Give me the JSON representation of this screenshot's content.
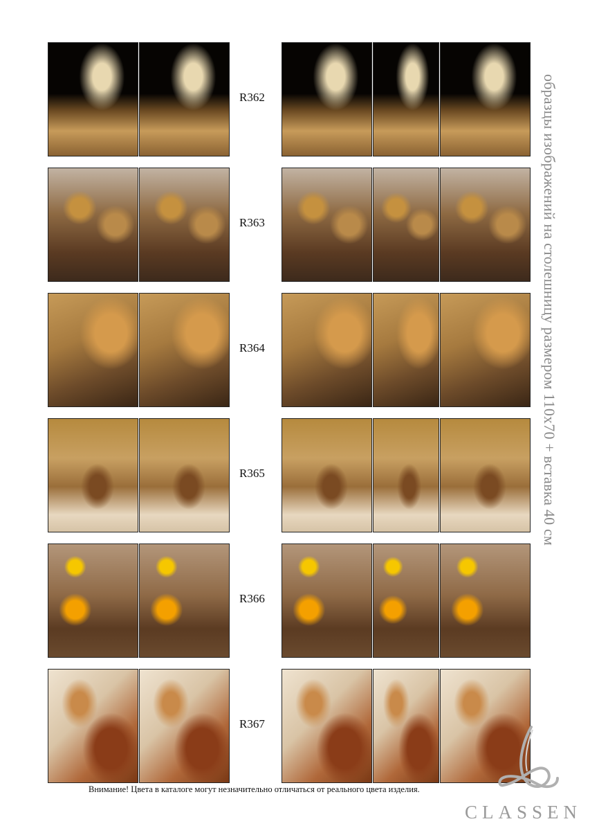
{
  "rows": [
    {
      "code": "R362",
      "theme": "t362"
    },
    {
      "code": "R363",
      "theme": "t363"
    },
    {
      "code": "R364",
      "theme": "t364"
    },
    {
      "code": "R365",
      "theme": "t365"
    },
    {
      "code": "R366",
      "theme": "t366"
    },
    {
      "code": "R367",
      "theme": "t367"
    }
  ],
  "side_caption": "образцы изображений на столешницу размером 110х70 + вставка 40 см",
  "notice": "Внимание! Цвета в каталоге могут незначительно отличаться от реального цвета изделия.",
  "brand": "CLASSEN",
  "colors": {
    "caption_gray": "#8a8a8a",
    "brand_gray": "#9a9a9a",
    "panel_border": "#222222"
  }
}
